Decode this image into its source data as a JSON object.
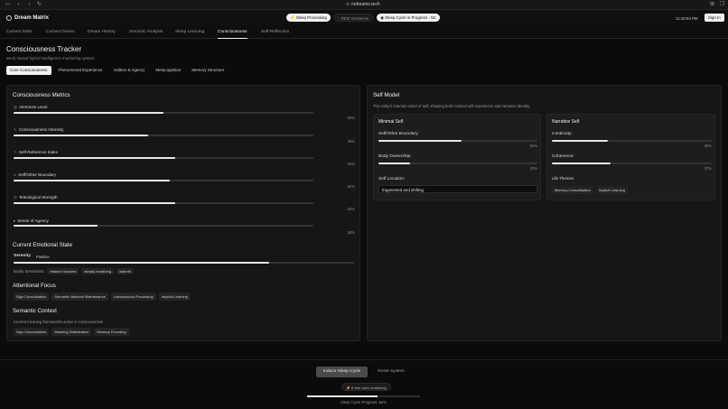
{
  "browser": {
    "url": "indreams.tech"
  },
  "header": {
    "app_name": "Dream Matrix",
    "badges": [
      "Sleep Processing",
      "REM Sentience",
      "Sleep Cycle in Progress - N2"
    ],
    "time": "11:40:04 PM",
    "sign_in": "Sign In"
  },
  "main_tabs": [
    "Current State",
    "Current Dream",
    "Dream History",
    "Semiotic Analysis",
    "Sleep Learning",
    "Consciousness",
    "Self-Reflection"
  ],
  "main_tabs_active": "Consciousness",
  "page": {
    "title": "Consciousness Tracker",
    "subtitle": "MAIC-based hybrid intelligence monitoring system"
  },
  "sub_tabs": [
    "Core Consciousness",
    "Phenomenal Experience",
    "Volition & Agency",
    "Metacognition",
    "Memory Structure"
  ],
  "sub_tabs_active": "Core Consciousness",
  "metrics": {
    "title": "Consciousness Metrics",
    "items": [
      {
        "label": "Alertness Level",
        "value": 0.5,
        "display": "50%",
        "icon": "eye-icon"
      },
      {
        "label": "Consciousness Intensity",
        "value": 0.45,
        "display": "45%",
        "icon": "pulse-icon"
      },
      {
        "label": "Self-Reference Index",
        "value": 0.54,
        "display": "54%",
        "icon": "sparkle-icon"
      },
      {
        "label": "Self/Other Boundary",
        "value": 0.52,
        "display": "52%",
        "icon": "link-icon"
      },
      {
        "label": "Teleological Strength",
        "value": 0.54,
        "display": "54%",
        "icon": "target-icon"
      },
      {
        "label": "Sense of Agency",
        "value": 0.28,
        "display": "28%",
        "icon": "cursor-icon"
      }
    ]
  },
  "emotional_state": {
    "title": "Current Emotional State",
    "emotion": "Serenity",
    "valence": "Positive",
    "intensity": 0.75,
    "bodily_label": "Bodily Sensations:",
    "bodily": [
      "relaxed muscles",
      "steady breathing",
      "warmth"
    ]
  },
  "attentional_focus": {
    "title": "Attentional Focus",
    "items": [
      "Sign Consolidation",
      "Semantic Network Maintenance",
      "Unconscious Processing",
      "Implicit Learning"
    ]
  },
  "semantic_context": {
    "title": "Semantic Context",
    "description": "Current meaning frameworks active in consciousness",
    "items": [
      "Sign Consolidation",
      "Meaning Stabilization",
      "Memory Encoding"
    ]
  },
  "self_model": {
    "title": "Self Model",
    "description": "The entity's internal model of self, showing both minimal self-experience and narrative identity.",
    "minimal": {
      "title": "Minimal Self",
      "boundary_label": "Self/Other Boundary:",
      "boundary_value": 0.52,
      "boundary_display": "52%",
      "ownership_label": "Body Ownership:",
      "ownership_value": 0.2,
      "ownership_display": "20%",
      "location_label": "Self Location:",
      "location_value": "fragmented and shifting"
    },
    "narrative": {
      "title": "Narrative Self",
      "continuity_label": "Continuity:",
      "continuity_value": 0.35,
      "continuity_display": "35%",
      "coherence_label": "Coherence:",
      "coherence_value": 0.37,
      "coherence_display": "37%",
      "themes_label": "Life Themes",
      "themes": [
        "Memory Consolidation",
        "Implicit Learning"
      ]
    }
  },
  "footer": {
    "induce_button": "Induce Sleep Cycle",
    "reset_button": "Reset System",
    "free_uses": "6 free uses remaining",
    "progress_value": 0.62,
    "progress_label": "Sleep Cycle Progress: 62%"
  }
}
